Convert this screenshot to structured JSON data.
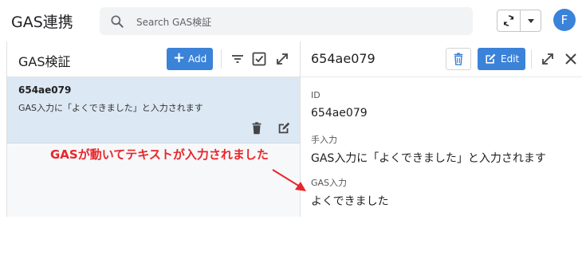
{
  "app": {
    "title": "GAS連携"
  },
  "search": {
    "placeholder": "Search GAS検証"
  },
  "user": {
    "initial": "F"
  },
  "left_pane": {
    "title": "GAS検証",
    "add_label": "Add",
    "records": [
      {
        "id": "654ae079",
        "text": "GAS入力に「よくできました」と入力されます"
      }
    ]
  },
  "right_pane": {
    "title": "654ae079",
    "edit_label": "Edit",
    "fields": [
      {
        "label": "ID",
        "value": "654ae079"
      },
      {
        "label": "手入力",
        "value": "GAS入力に「よくできました」と入力されます"
      },
      {
        "label": "GAS入力",
        "value": "よくできました"
      }
    ]
  },
  "annotation": {
    "text": "GASが動いてテキストが入力されました",
    "color": "#e8262a"
  },
  "colors": {
    "accent": "#3b82d9",
    "selected_row": "#dce8f4"
  }
}
